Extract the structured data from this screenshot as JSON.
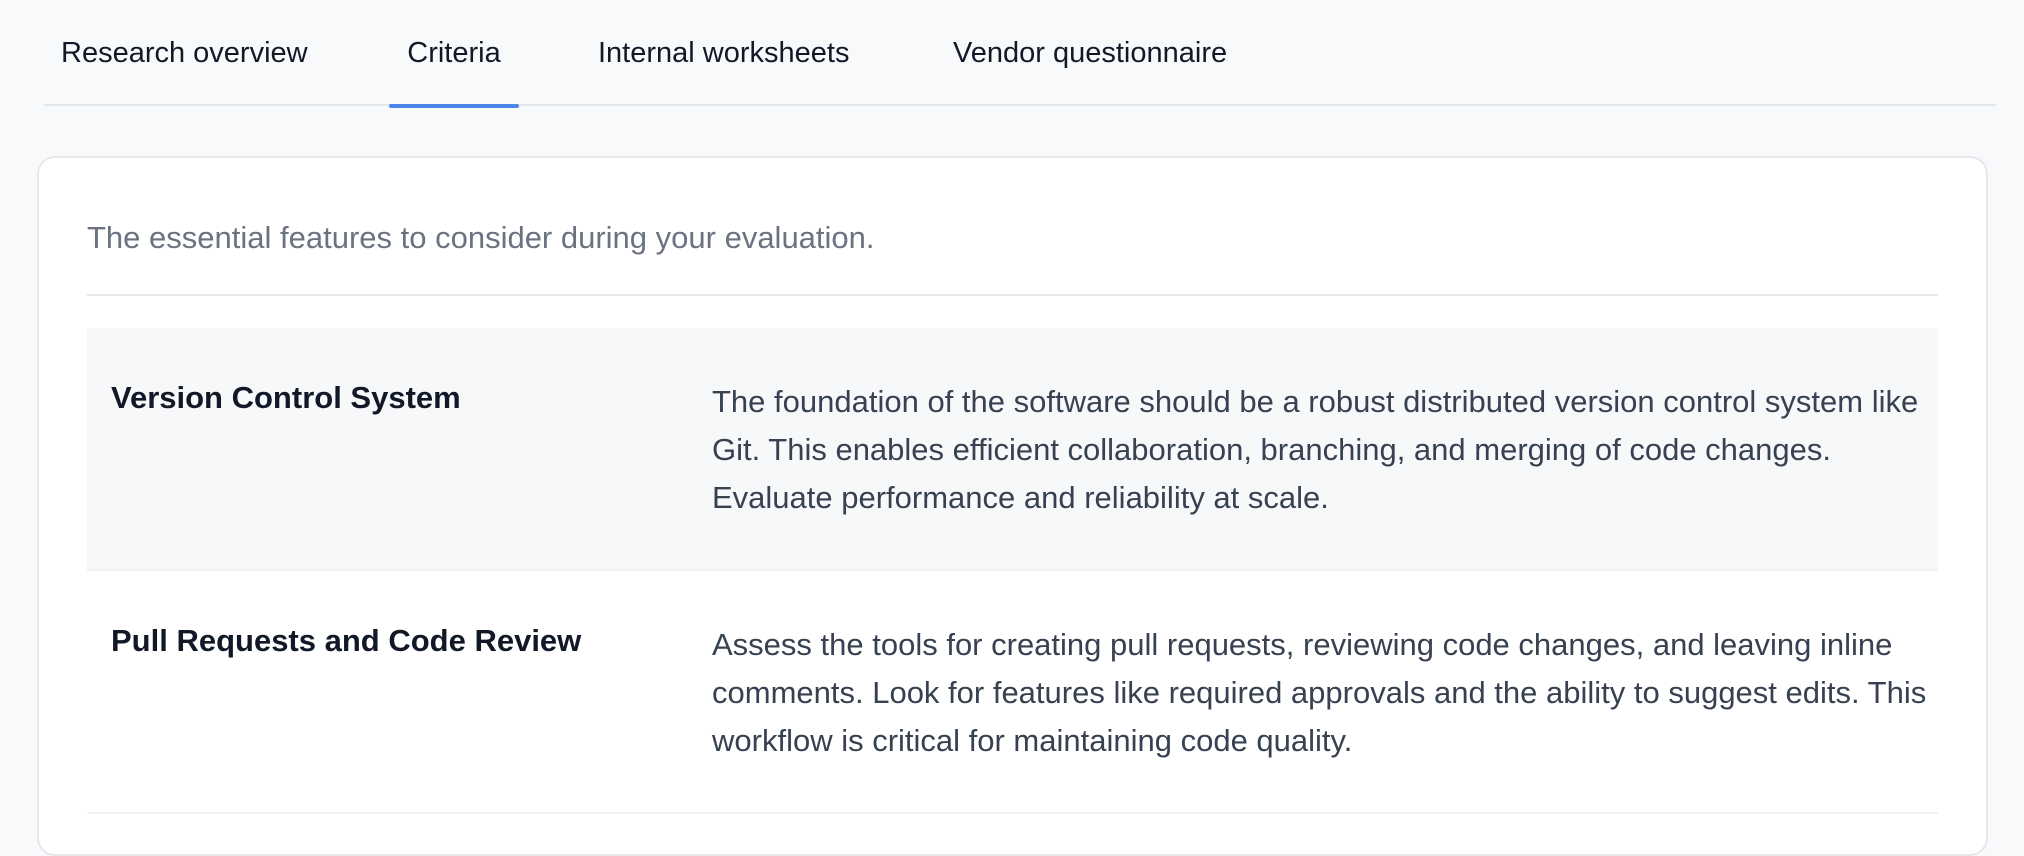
{
  "tabs": [
    {
      "label": "Research overview",
      "active": false
    },
    {
      "label": "Criteria",
      "active": true
    },
    {
      "label": "Internal worksheets",
      "active": false
    },
    {
      "label": "Vendor questionnaire",
      "active": false
    }
  ],
  "card": {
    "intro": "The essential features to consider during your evaluation.",
    "criteria": [
      {
        "title": "Version Control System",
        "description": "The foundation of the software should be a robust distributed version control system like Git. This enables efficient collaboration, branching, and merging of code changes. Evaluate performance and reliability at scale."
      },
      {
        "title": "Pull Requests and Code Review",
        "description": "Assess the tools for creating pull requests, reviewing code changes, and leaving inline comments. Look for features like required approvals and the ability to suggest edits. This workflow is critical for maintaining code quality."
      }
    ]
  },
  "colors": {
    "accent": "#4a86e8",
    "page_background": "#f8f9fb",
    "card_background": "#ffffff",
    "row_shade": "#f7f8fa",
    "muted_text": "#6b7280"
  }
}
